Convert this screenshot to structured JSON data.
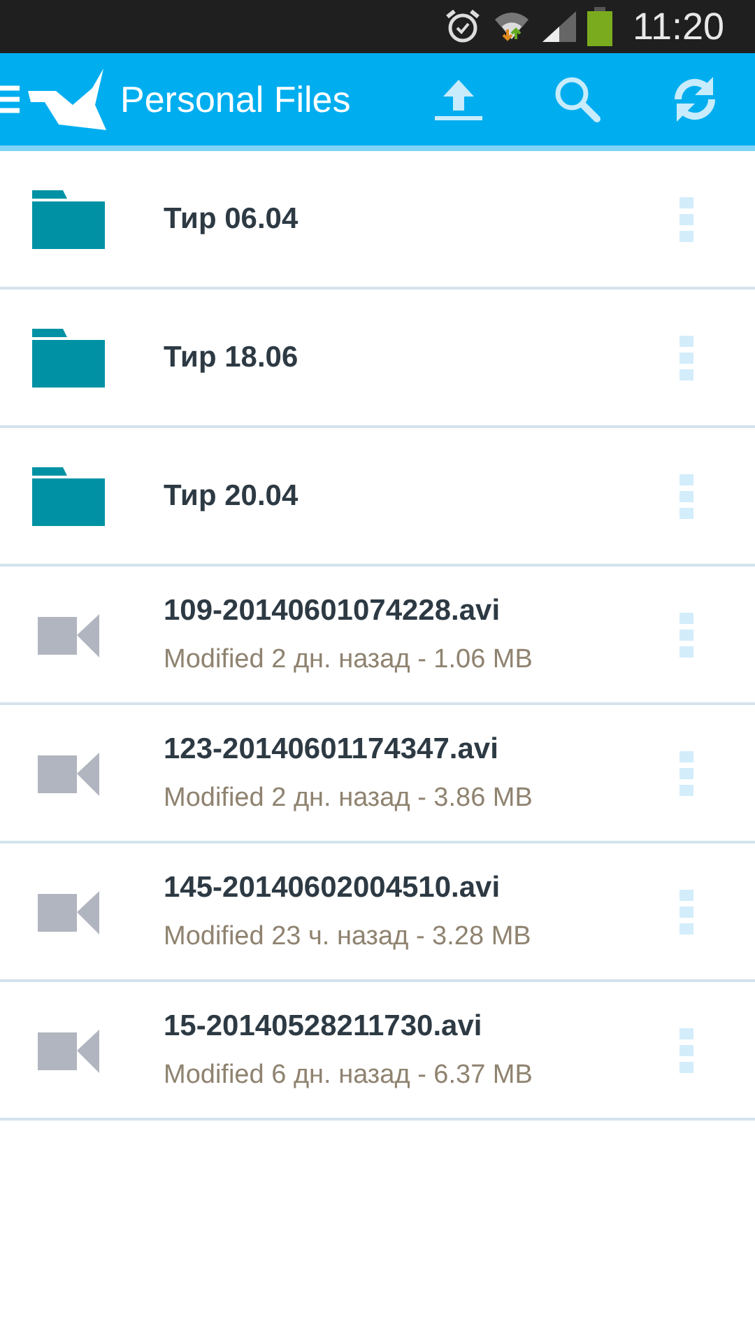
{
  "status_bar": {
    "time": "11:20"
  },
  "app_bar": {
    "title": "Personal Files"
  },
  "files": [
    {
      "kind": "folder",
      "name": "Тир 06.04"
    },
    {
      "kind": "folder",
      "name": "Тир 18.06"
    },
    {
      "kind": "folder",
      "name": "Тир 20.04"
    },
    {
      "kind": "video",
      "name": "109-20140601074228.avi",
      "details": "Modified 2 дн. назад - 1.06 MB"
    },
    {
      "kind": "video",
      "name": "123-20140601174347.avi",
      "details": "Modified 2 дн. назад - 3.86 MB"
    },
    {
      "kind": "video",
      "name": "145-20140602004510.avi",
      "details": "Modified 23 ч. назад - 3.28 MB"
    },
    {
      "kind": "video",
      "name": "15-20140528211730.avi",
      "details": "Modified 6 дн. назад - 6.37 MB"
    }
  ]
}
